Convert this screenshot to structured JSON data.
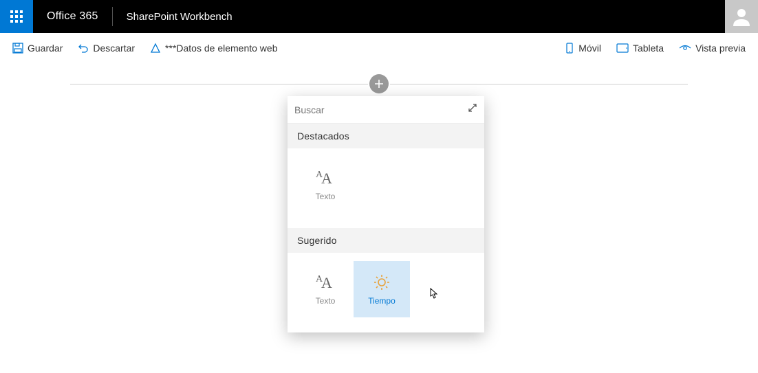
{
  "header": {
    "brand": "Office 365",
    "app": "SharePoint Workbench"
  },
  "commands": {
    "save": "Guardar",
    "discard": "Descartar",
    "webPartData": "***Datos de elemento web",
    "mobile": "Móvil",
    "tablet": "Tableta",
    "preview": "Vista previa"
  },
  "picker": {
    "searchPlaceholder": "Buscar",
    "section1": {
      "title": "Destacados",
      "items": [
        {
          "label": "Texto"
        }
      ]
    },
    "section2": {
      "title": "Sugerido",
      "items": [
        {
          "label": "Texto"
        },
        {
          "label": "Tiempo"
        }
      ]
    }
  }
}
